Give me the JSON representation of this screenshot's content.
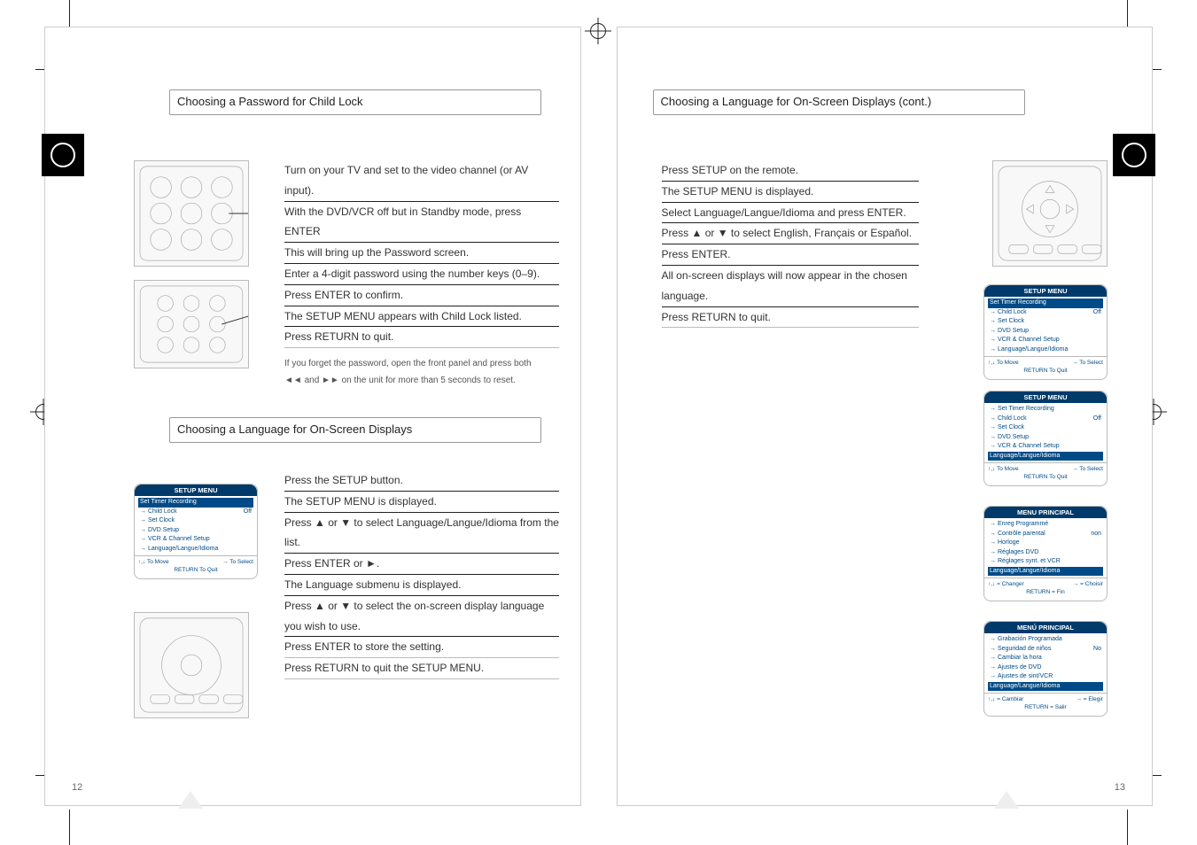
{
  "crops": {},
  "leftPage": {
    "title1": "Choosing a Password for Child Lock",
    "title2": "Choosing a Language for On-Screen Displays",
    "steps1": [
      "Turn on your TV and set to the video channel (or AV input).",
      "With the DVD/VCR off but in Standby mode, press ENTER",
      "This will bring up the Password screen.",
      "Enter a 4-digit password using the number keys (0–9).",
      "Press ENTER to confirm.",
      "The SETUP MENU appears with Child Lock listed.",
      "Press RETURN to quit."
    ],
    "steps2": [
      "Press the SETUP button.",
      "The SETUP MENU is displayed.",
      "Press ▲ or ▼ to select Language/Langue/Idioma from the list.",
      "Press ENTER or ►.",
      "The Language submenu is displayed.",
      "Press ▲ or ▼ to select the on-screen display language you wish to use.",
      "Press ENTER to store the setting.",
      "Press RETURN to quit the SETUP MENU."
    ],
    "osd1": {
      "header": "SETUP MENU",
      "items": [
        {
          "label": "Set Timer Recording",
          "sel": true
        },
        {
          "label": "Child Lock",
          "val": "Off"
        },
        {
          "label": "Set Clock"
        },
        {
          "label": "DVD Setup"
        },
        {
          "label": "VCR & Channel Setup"
        },
        {
          "label": "Language/Langue/Idioma"
        }
      ],
      "footL": "↑,↓  To  Move",
      "footR": "→ To Select",
      "footC": "RETURN To Quit"
    },
    "note1": "If you forget the password, open the front panel and press both ◄◄ and ►► on the unit for more than 5 seconds to reset.",
    "pageNum": "12"
  },
  "rightPage": {
    "title1": "Choosing a Language for On-Screen Displays (cont.)",
    "steps1": [
      "Press SETUP on the remote.",
      "The SETUP MENU is displayed.",
      "Select Language/Langue/Idioma and press ENTER.",
      "Press ▲ or ▼ to select English, Français or Español.",
      "Press ENTER.",
      "All on-screen displays will now appear in the chosen language.",
      "Press RETURN to quit."
    ],
    "osdEN": {
      "header": "SETUP MENU",
      "items": [
        {
          "label": "Set Timer Recording",
          "sel": true
        },
        {
          "label": "Child Lock",
          "val": "Off"
        },
        {
          "label": "Set Clock"
        },
        {
          "label": "DVD Setup"
        },
        {
          "label": "VCR & Channel Setup"
        },
        {
          "label": "Language/Langue/Idioma"
        }
      ],
      "footL": "↑,↓  To  Move",
      "footR": "→ To Select",
      "footC": "RETURN To Quit"
    },
    "osdEN2": {
      "header": "SETUP MENU",
      "items": [
        {
          "label": "Set Timer Recording"
        },
        {
          "label": "Child Lock",
          "val": "Off"
        },
        {
          "label": "Set Clock"
        },
        {
          "label": "DVD Setup"
        },
        {
          "label": "VCR & Channel Setup"
        },
        {
          "label": "Language/Langue/Idioma",
          "sel": true
        }
      ],
      "footL": "↑,↓  To  Move",
      "footR": "→ To Select",
      "footC": "RETURN To Quit"
    },
    "osdFR": {
      "header": "MENU PRINCIPAL",
      "items": [
        {
          "label": "Enreg Programmé"
        },
        {
          "label": "Contrôle parental",
          "val": "non"
        },
        {
          "label": "Horloge"
        },
        {
          "label": "Réglages DVD"
        },
        {
          "label": "Réglages synt. et VCR"
        },
        {
          "label": "Language/Langue/Idioma",
          "sel": true
        }
      ],
      "footL": "↑,↓  = Changer",
      "footR": "→ = Choisir",
      "footC": "RETURN = Fin"
    },
    "osdES": {
      "header": "MENÚ PRINCIPAL",
      "items": [
        {
          "label": "Grabación Programada"
        },
        {
          "label": "Seguridad de niños",
          "val": "No"
        },
        {
          "label": "Cambiar la hora"
        },
        {
          "label": "Ajustes de DVD"
        },
        {
          "label": "Ajustes de sint/VCR"
        },
        {
          "label": "Language/Langue/Idioma",
          "sel": true
        }
      ],
      "footL": "↑,↓ = Cambiar",
      "footR": "→ = Elegir",
      "footC": "RETURN = Salir"
    },
    "pageNum": "13"
  }
}
